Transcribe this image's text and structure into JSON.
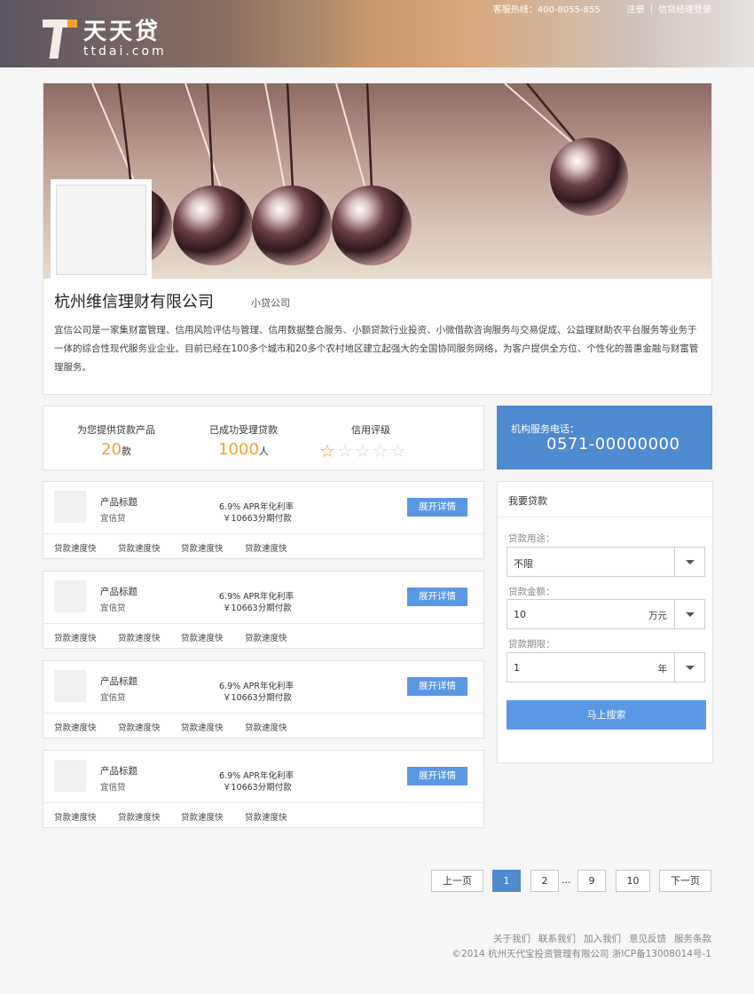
{
  "header": {
    "logo_cn": "天天贷",
    "logo_en": "ttdai.com",
    "hotline": "客服热线：400-8055-855",
    "register": "注册",
    "separator": "|",
    "manager_login": "信贷经理登录"
  },
  "profile": {
    "company_name": "杭州维信理财有限公司",
    "company_type": "小贷公司",
    "description": "宜信公司是一家集财富管理、信用风险评估与管理、信用数据整合服务、小额贷款行业投资、小微借款咨询服务与交易促成、公益理财助农平台服务等业务于一体的综合性现代服务业企业。目前已经在100多个城市和20多个农村地区建立起强大的全国协同服务网络，为客户提供全方位、个性化的普惠金融与财富管理服务。"
  },
  "stats": {
    "products_label": "为您提供贷款产品",
    "products_value": "20",
    "products_unit": "款",
    "loans_label": "已成功受理贷款",
    "loans_value": "1000",
    "loans_unit": "人",
    "rating_label": "信用评级",
    "rating": 1,
    "rating_max": 5
  },
  "service": {
    "label": "机构服务电话：",
    "phone": "0571-00000000"
  },
  "products": [
    {
      "title": "产品标题",
      "sub": "宜信贷",
      "apr": "6.9% APR年化利率",
      "pay": "￥10663分期付款",
      "btn": "展开详情",
      "tags": [
        "贷款速度快",
        "贷款速度快",
        "贷款速度快",
        "贷款速度快"
      ]
    },
    {
      "title": "产品标题",
      "sub": "宜信贷",
      "apr": "6.9% APR年化利率",
      "pay": "￥10663分期付款",
      "btn": "展开详情",
      "tags": [
        "贷款速度快",
        "贷款速度快",
        "贷款速度快",
        "贷款速度快"
      ]
    },
    {
      "title": "产品标题",
      "sub": "宜信贷",
      "apr": "6.9% APR年化利率",
      "pay": "￥10663分期付款",
      "btn": "展开详情",
      "tags": [
        "贷款速度快",
        "贷款速度快",
        "贷款速度快",
        "贷款速度快"
      ]
    },
    {
      "title": "产品标题",
      "sub": "宜信贷",
      "apr": "6.9% APR年化利率",
      "pay": "￥10663分期付款",
      "btn": "展开详情",
      "tags": [
        "贷款速度快",
        "贷款速度快",
        "贷款速度快",
        "贷款速度快"
      ]
    }
  ],
  "loan": {
    "title": "我要贷款",
    "purpose_label": "贷款用途：",
    "purpose_value": "不限",
    "amount_label": "贷款金额：",
    "amount_value": "10",
    "amount_unit": "万元",
    "term_label": "贷款期限：",
    "term_value": "1",
    "term_unit": "年",
    "search_btn": "马上搜索"
  },
  "pagination": {
    "prev": "上一页",
    "pages": [
      "1",
      "2",
      "9",
      "10"
    ],
    "current": "1",
    "ellipsis": "...",
    "next": "下一页"
  },
  "footer": {
    "links": [
      "关于我们",
      "联系我们",
      "加入我们",
      "意见反馈",
      "服务条款"
    ],
    "copyright": "©2014 杭州天代宝投资管理有限公司 浙ICP备13008014号-1"
  },
  "colors": {
    "accent_blue": "#4f89cf",
    "button_blue": "#5b98e4",
    "highlight_orange": "#f0a230"
  }
}
